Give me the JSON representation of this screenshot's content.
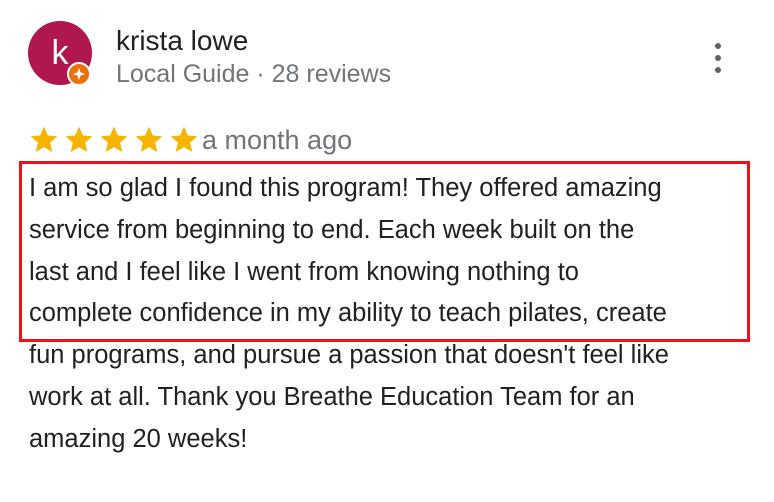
{
  "review": {
    "author": {
      "initial": "k",
      "name": "krista lowe",
      "meta": "Local Guide · 28 reviews",
      "avatar_color": "#b0174f",
      "badge_color": "#e8710a",
      "badge_icon": "local-guide-badge-icon"
    },
    "menu_icon": "more-vert-icon",
    "rating": 5,
    "rating_max": 5,
    "star_color": "#f4b400",
    "date": "a month ago",
    "text_lines": [
      "I am so glad I found this program! They offered amazing",
      "service from beginning to end. Each week built on the",
      "last and I feel like I went from knowing nothing to",
      "complete confidence in my ability to teach pilates, create",
      "fun programs, and pursue a passion that doesn't feel like",
      "work at all. Thank you Breathe Education Team for an",
      "amazing 20 weeks!"
    ],
    "highlight_color": "#e8141b"
  }
}
